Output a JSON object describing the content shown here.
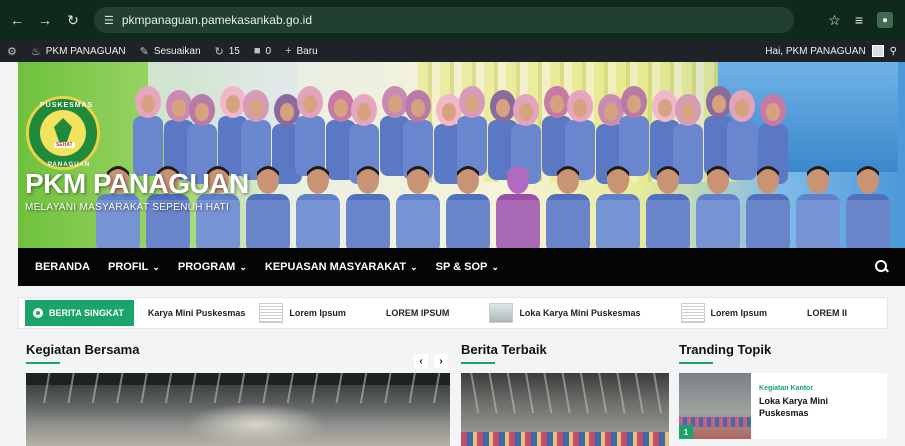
{
  "browser": {
    "url": "pkmpanaguan.pamekasankab.go.id"
  },
  "admin_bar": {
    "site_name": "PKM PANAGUAN",
    "customize": "Sesuaikan",
    "updates_count": "15",
    "comments_count": "0",
    "new_label": "Baru",
    "greeting": "Hai, PKM PANAGUAN"
  },
  "hero": {
    "title": "PKM PANAGUAN",
    "tagline": "MELAYANI MASYARAKAT SEPENUH HATI",
    "logo_top": "PUSKESMAS",
    "logo_mid": "SEHAT",
    "logo_bottom": "PANAGUAN"
  },
  "nav": {
    "items": [
      {
        "label": "BERANDA",
        "dropdown": false
      },
      {
        "label": "PROFIL",
        "dropdown": true
      },
      {
        "label": "PROGRAM",
        "dropdown": true
      },
      {
        "label": "KEPUASAN MASYARAKAT",
        "dropdown": true
      },
      {
        "label": "SP & SOP",
        "dropdown": true
      }
    ]
  },
  "ticker": {
    "label": "BERITA SINGKAT",
    "items": [
      {
        "title": "Karya Mini Puskesmas",
        "thumb": "none"
      },
      {
        "title": "Lorem Ipsum",
        "thumb": "doc"
      },
      {
        "title": "LOREM IPSUM",
        "thumb": "none"
      },
      {
        "title": "Loka Karya Mini Puskesmas",
        "thumb": "photo"
      },
      {
        "title": "Lorem Ipsum",
        "thumb": "doc"
      },
      {
        "title": "LOREM II",
        "thumb": "none"
      }
    ]
  },
  "sections": {
    "kegiatan": "Kegiatan Bersama",
    "berita": "Berita Terbaik",
    "tranding": "Tranding Topik"
  },
  "topik_card": {
    "rank": "1",
    "category": "Kegiatan Kantor",
    "title": "Loka Karya Mini Puskesmas"
  },
  "colors": {
    "accent": "#1aa36b",
    "nav_bg": "#050505",
    "admin_bg": "#1d2327"
  }
}
